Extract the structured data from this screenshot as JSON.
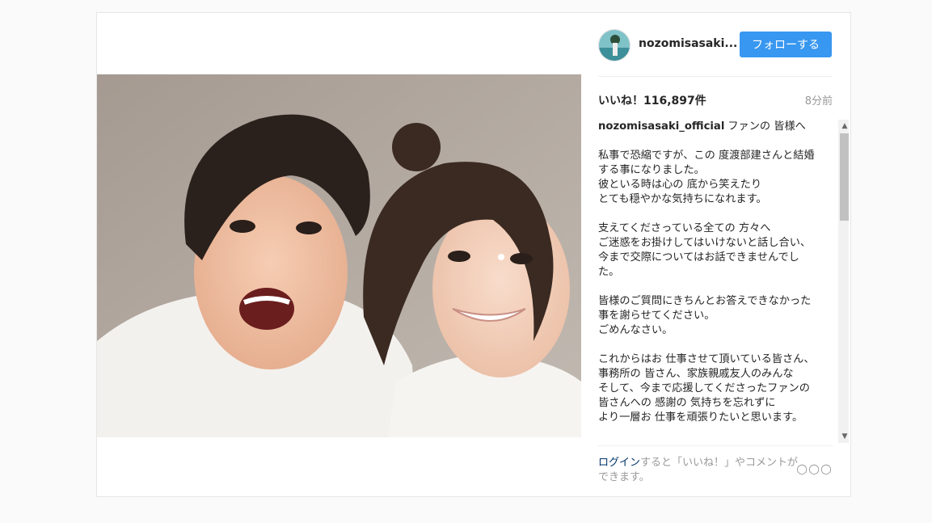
{
  "post": {
    "username": "nozomisasaki...",
    "follow_label": "フォローする",
    "likes": "いいね！116,897件",
    "time": "8分前",
    "caption_author": "nozomisasaki_official",
    "caption_first": "ファンの 皆様へ",
    "caption_paragraphs": [
      "私事で恐縮ですが、この 度渡部建さんと結婚する事になりました。\n彼といる時は心の 底から笑えたり\nとても穏やかな気持ちになれます。",
      "支えてくださっている全ての 方々へ\nご迷惑をお掛けしてはいけないと話し合い、今まで交際についてはお話できませんでした。",
      "皆様のご質問にきちんとお答えできなかった事を謝らせてください。\nごめんなさい。",
      "これからはお 仕事させて頂いている皆さん、事務所の 皆さん、家族親戚友人のみんな\nそして、今まで応援してくださったファンの皆さんへの 感謝の 気持ちを忘れずに\nより一層お 仕事を頑張りたいと思います。"
    ],
    "login_link": "ログイン",
    "login_rest": "すると「いいね！」やコメントができます。",
    "more_icon_text": "○○○"
  },
  "icons": {
    "scroll_up": "▲",
    "scroll_down": "▼"
  }
}
